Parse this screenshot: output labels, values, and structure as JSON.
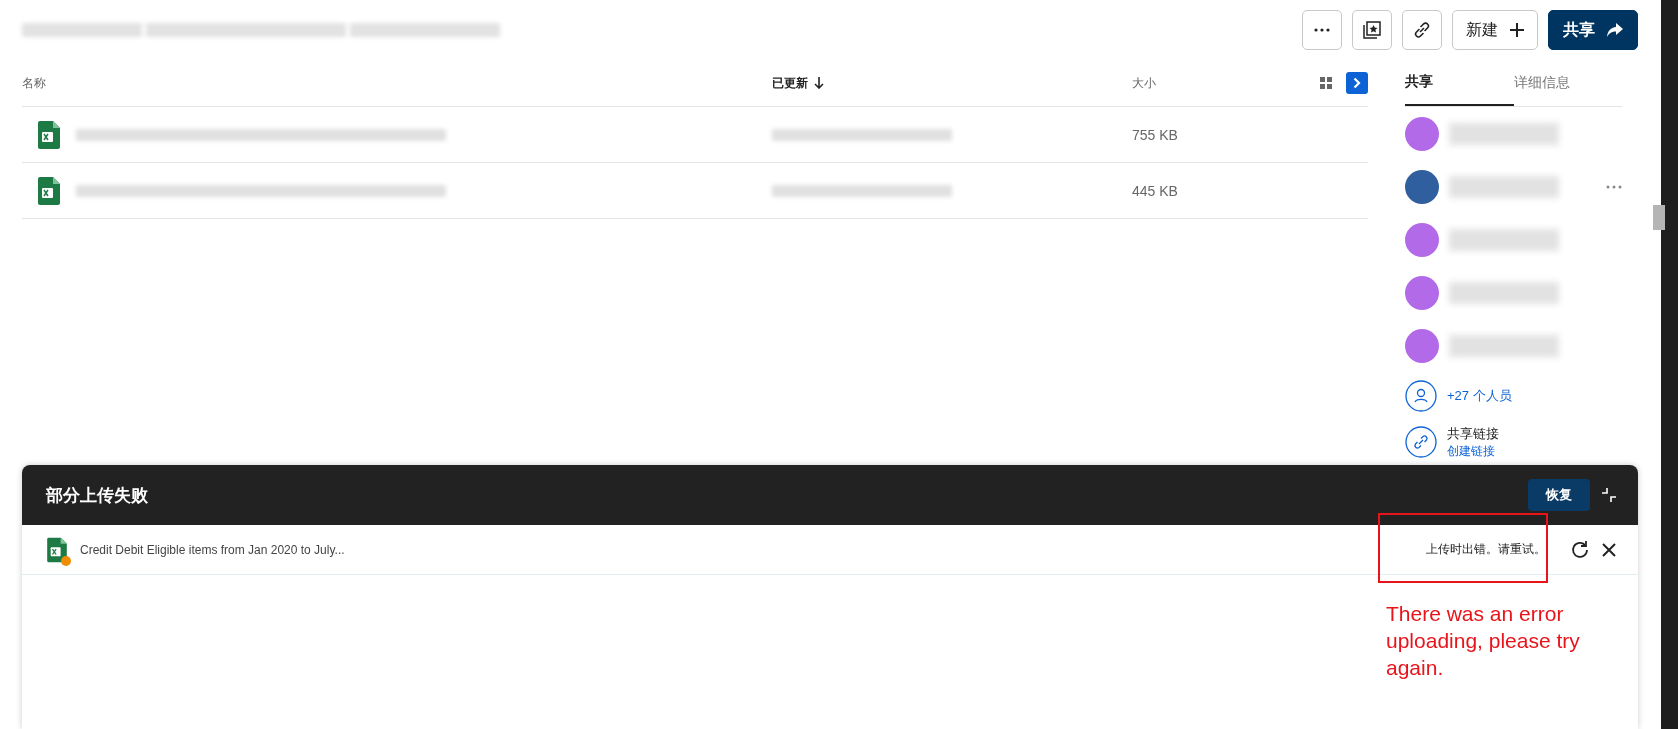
{
  "toolbar": {
    "buttons": [
      {
        "kind": "more"
      },
      {
        "kind": "collection"
      },
      {
        "kind": "link"
      },
      {
        "kind": "new",
        "label": "新建"
      },
      {
        "kind": "share",
        "label": "共享"
      }
    ]
  },
  "file_list": {
    "columns": [
      {
        "label": "名称",
        "sorted": false
      },
      {
        "label": "已更新",
        "sorted": true
      },
      {
        "label": "大小",
        "sorted": false
      }
    ],
    "rows": [
      {
        "size": "755 KB"
      },
      {
        "size": "445 KB"
      }
    ]
  },
  "share_panel": {
    "tabs": [
      {
        "label": "共享",
        "selected": true
      },
      {
        "label": "详细信息",
        "selected": false
      }
    ],
    "people": [
      {
        "color": "#b36ae8"
      },
      {
        "color": "#2f5f9e"
      },
      {
        "color": "#b36ae8"
      },
      {
        "color": "#b36ae8"
      },
      {
        "color": "#b36ae8"
      }
    ],
    "more_people": "+27 个人员",
    "share_link": {
      "title": "共享链接",
      "action": "创建链接"
    }
  },
  "upload_panel": {
    "title": "部分上传失败",
    "restore": "恢复",
    "items": [
      {
        "name": "Credit Debit Eligible items from Jan 2020 to July...",
        "status": "上传时出错。请重试。",
        "warning": true
      }
    ]
  },
  "annotation": {
    "text": "There was an error uploading, please try again."
  }
}
